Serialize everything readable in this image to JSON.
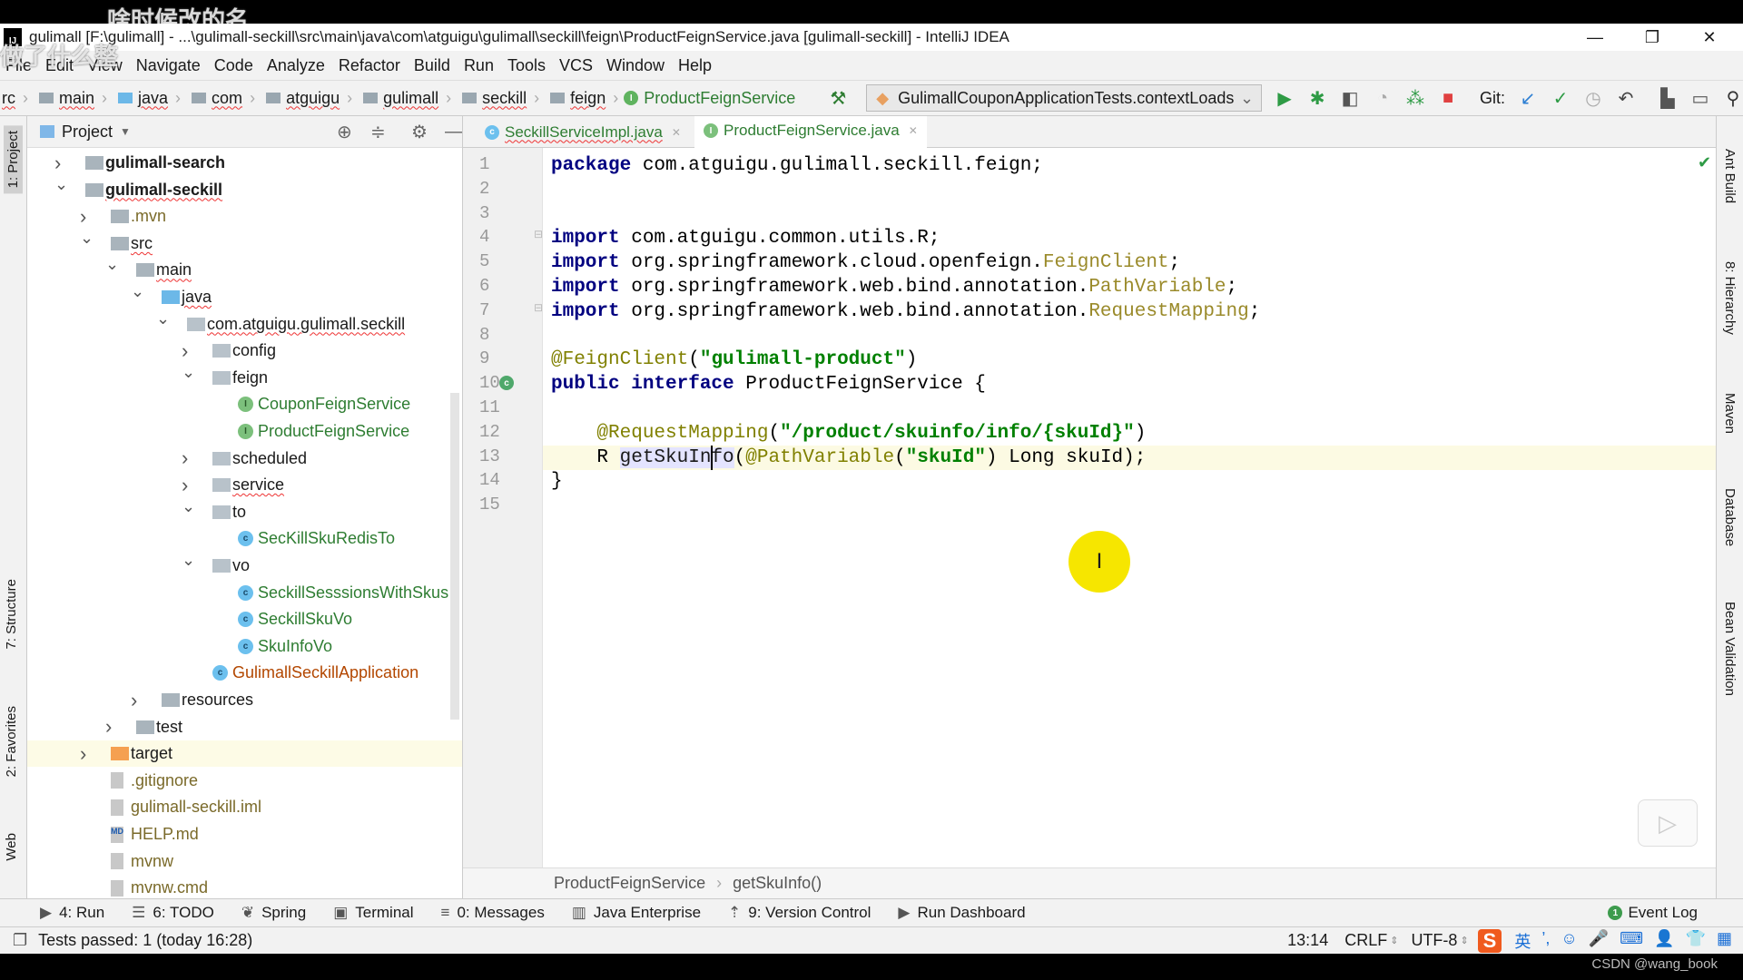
{
  "overlay_text": [
    "啥时候改的名",
    "做了什么整"
  ],
  "window": {
    "title": "gulimall [F:\\gulimall] - ...\\gulimall-seckill\\src\\main\\java\\com\\atguigu\\gulimall\\seckill\\feign\\ProductFeignService.java [gulimall-seckill] - IntelliJ IDEA",
    "app_icon": "IJ",
    "minimize": "—",
    "restore": "❐",
    "close": "✕"
  },
  "menu": [
    "File",
    "Edit",
    "View",
    "Navigate",
    "Code",
    "Analyze",
    "Refactor",
    "Build",
    "Run",
    "Tools",
    "VCS",
    "Window",
    "Help"
  ],
  "nav": {
    "crumbs": [
      "rc",
      "main",
      "java",
      "com",
      "atguigu",
      "gulimall",
      "seckill",
      "feign"
    ],
    "current": "ProductFeignService",
    "run_config": "GulimallCouponApplicationTests.contextLoads",
    "git_label": "Git:"
  },
  "left_strip": [
    "1: Project",
    "7: Structure",
    "2: Favorites",
    "Web"
  ],
  "right_strip": [
    "Ant Build",
    "8: Hierarchy",
    "Maven",
    "Database",
    "Bean Validation"
  ],
  "project": {
    "title": "Project",
    "tree": [
      {
        "label": "gulimall-search",
        "depth": 0,
        "arrow": "right",
        "icon": "module",
        "bold": true
      },
      {
        "label": "gulimall-seckill",
        "depth": 0,
        "arrow": "down",
        "icon": "module",
        "bold": true,
        "squig": true
      },
      {
        "label": ".mvn",
        "depth": 1,
        "arrow": "right",
        "icon": "folder",
        "color": "#7a6a2a"
      },
      {
        "label": "src",
        "depth": 1,
        "arrow": "down",
        "icon": "folder",
        "squig": true
      },
      {
        "label": "main",
        "depth": 2,
        "arrow": "down",
        "icon": "folder",
        "squig": true
      },
      {
        "label": "java",
        "depth": 3,
        "arrow": "down",
        "icon": "java-folder",
        "squig": true
      },
      {
        "label": "com.atguigu.gulimall.seckill",
        "depth": 4,
        "arrow": "down",
        "icon": "package",
        "squig": true
      },
      {
        "label": "config",
        "depth": 5,
        "arrow": "right",
        "icon": "package"
      },
      {
        "label": "feign",
        "depth": 5,
        "arrow": "down",
        "icon": "package"
      },
      {
        "label": "CouponFeignService",
        "depth": 6,
        "icon": "interface",
        "color": "#2e7d32"
      },
      {
        "label": "ProductFeignService",
        "depth": 6,
        "icon": "interface",
        "color": "#2e7d32"
      },
      {
        "label": "scheduled",
        "depth": 5,
        "arrow": "right",
        "icon": "package"
      },
      {
        "label": "service",
        "depth": 5,
        "arrow": "right",
        "icon": "package",
        "squig": true
      },
      {
        "label": "to",
        "depth": 5,
        "arrow": "down",
        "icon": "package"
      },
      {
        "label": "SecKillSkuRedisTo",
        "depth": 6,
        "icon": "class",
        "color": "#2e7d32"
      },
      {
        "label": "vo",
        "depth": 5,
        "arrow": "down",
        "icon": "package"
      },
      {
        "label": "SeckillSesssionsWithSkus",
        "depth": 6,
        "icon": "class",
        "color": "#2e7d32"
      },
      {
        "label": "SeckillSkuVo",
        "depth": 6,
        "icon": "class",
        "color": "#2e7d32"
      },
      {
        "label": "SkuInfoVo",
        "depth": 6,
        "icon": "class",
        "color": "#2e7d32"
      },
      {
        "label": "GulimallSeckillApplication",
        "depth": 5,
        "icon": "spring-app",
        "color": "#b34700"
      },
      {
        "label": "resources",
        "depth": 3,
        "arrow": "right",
        "icon": "resources"
      },
      {
        "label": "test",
        "depth": 2,
        "arrow": "right",
        "icon": "folder"
      },
      {
        "label": "target",
        "depth": 1,
        "arrow": "right",
        "icon": "target-folder",
        "highlight": true
      },
      {
        "label": ".gitignore",
        "depth": 1,
        "icon": "file",
        "color": "#7a6a2a"
      },
      {
        "label": "gulimall-seckill.iml",
        "depth": 1,
        "icon": "iml",
        "color": "#7a6a2a"
      },
      {
        "label": "HELP.md",
        "depth": 1,
        "icon": "md",
        "color": "#7a6a2a"
      },
      {
        "label": "mvnw",
        "depth": 1,
        "icon": "file",
        "color": "#7a6a2a"
      },
      {
        "label": "mvnw.cmd",
        "depth": 1,
        "icon": "file",
        "color": "#7a6a2a"
      }
    ]
  },
  "tabs": [
    {
      "label": "SeckillServiceImpl.java",
      "badge": "c",
      "active": false
    },
    {
      "label": "ProductFeignService.java",
      "badge": "I",
      "active": true
    }
  ],
  "code": [
    [
      [
        "package ",
        "kw"
      ],
      [
        "com.atguigu.gulimall.seckill.feign;",
        "pl"
      ]
    ],
    [],
    [],
    [
      [
        "import ",
        "kw"
      ],
      [
        "com.atguigu.common.utils.R;",
        "pl"
      ]
    ],
    [
      [
        "import ",
        "kw"
      ],
      [
        "org.springframework.cloud.openfeign.",
        "pl"
      ],
      [
        "FeignClient",
        "ty"
      ],
      [
        ";",
        "pl"
      ]
    ],
    [
      [
        "import ",
        "kw"
      ],
      [
        "org.springframework.web.bind.annotation.",
        "pl"
      ],
      [
        "PathVariable",
        "ty"
      ],
      [
        ";",
        "pl"
      ]
    ],
    [
      [
        "import ",
        "kw"
      ],
      [
        "org.springframework.web.bind.annotation.",
        "pl"
      ],
      [
        "RequestMapping",
        "ty"
      ],
      [
        ";",
        "pl"
      ]
    ],
    [],
    [
      [
        "@FeignClient",
        "an"
      ],
      [
        "(",
        "pl"
      ],
      [
        "\"gulimall-product\"",
        "st"
      ],
      [
        ")",
        "pl"
      ]
    ],
    [
      [
        "public interface ",
        "kw"
      ],
      [
        "ProductFeignService {",
        "pl"
      ]
    ],
    [],
    [
      [
        "    ",
        "pl"
      ],
      [
        "@RequestMapping",
        "an"
      ],
      [
        "(",
        "pl"
      ],
      [
        "\"/product/skuinfo/info/{skuId}\"",
        "st"
      ],
      [
        ")",
        "pl"
      ]
    ],
    [
      [
        "    R ",
        "pl"
      ],
      [
        "getSkuInfo",
        "hl"
      ],
      [
        "(",
        "pl"
      ],
      [
        "@PathVariable",
        "an"
      ],
      [
        "(",
        "pl"
      ],
      [
        "\"skuId\"",
        "st"
      ],
      [
        ") Long skuId);",
        "pl"
      ]
    ],
    [
      [
        "}",
        "pl"
      ]
    ],
    []
  ],
  "current_line": 13,
  "editor_breadcrumb": [
    "ProductFeignService",
    "getSkuInfo()"
  ],
  "tool_tabs": [
    {
      "icon": "▶",
      "label": "4: Run"
    },
    {
      "icon": "☰",
      "label": "6: TODO"
    },
    {
      "icon": "❦",
      "label": "Spring"
    },
    {
      "icon": "▣",
      "label": "Terminal"
    },
    {
      "icon": "≡",
      "label": "0: Messages"
    },
    {
      "icon": "▥",
      "label": "Java Enterprise"
    },
    {
      "icon": "⇡",
      "label": "9: Version Control"
    },
    {
      "icon": "▶",
      "label": "Run Dashboard"
    }
  ],
  "event_log": {
    "badge": "1",
    "label": "Event Log"
  },
  "status": {
    "message": "Tests passed: 1 (today 16:28)",
    "position": "13:14",
    "line_sep": "CRLF",
    "encoding": "UTF-8",
    "ime": [
      "S",
      "英",
      "’,",
      "☺",
      "🎤",
      "⌨",
      "👤",
      "👕",
      "▦"
    ]
  },
  "watermark": "CSDN @wang_book"
}
